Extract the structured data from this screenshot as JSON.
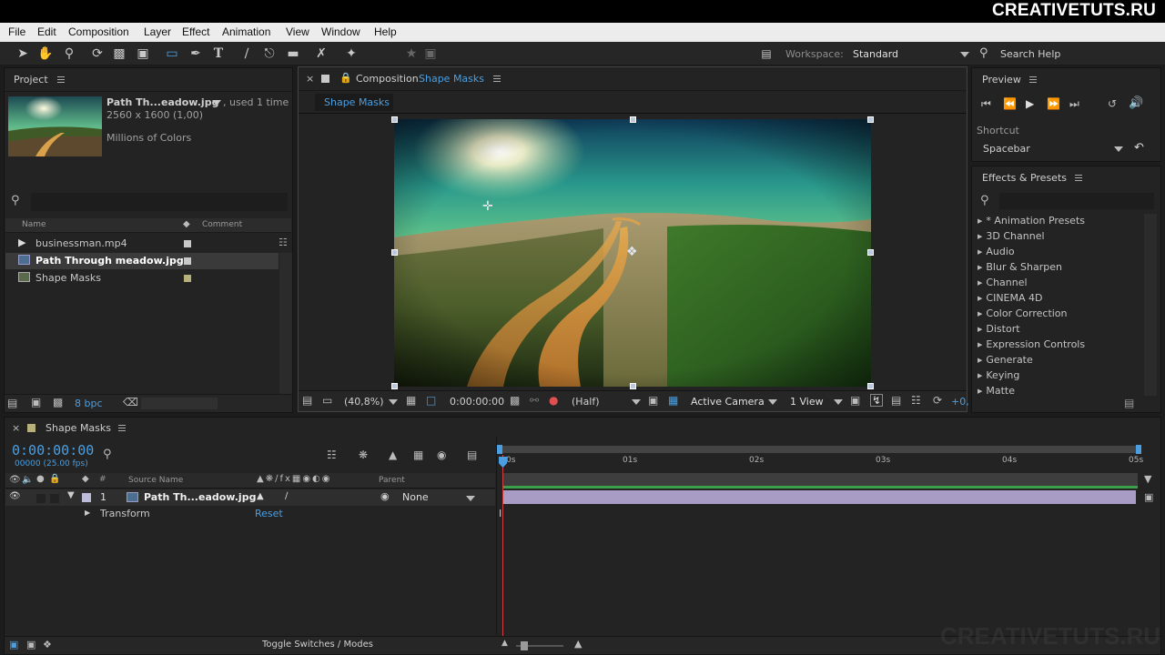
{
  "watermark": "CREATIVETUTS.RU",
  "menu": [
    "File",
    "Edit",
    "Composition",
    "Layer",
    "Effect",
    "Animation",
    "View",
    "Window",
    "Help"
  ],
  "toolbar": {
    "workspace_label": "Workspace:",
    "workspace_value": "Standard",
    "search_help_label": "Search Help"
  },
  "project": {
    "title": "Project",
    "preview_name": "Path Th...eadow.jpg",
    "preview_used": ", used 1 time",
    "preview_dims": "2560 x 1600 (1,00)",
    "preview_colors": "Millions of Colors",
    "columns": {
      "name": "Name",
      "comment": "Comment"
    },
    "items": [
      {
        "name": "businessman.mp4",
        "color": "#c9c9c9"
      },
      {
        "name": "Path Through meadow.jpg",
        "color": "#c9c9c9"
      },
      {
        "name": "Shape Masks",
        "color": "#b8b07a"
      }
    ],
    "bpc": "8 bpc"
  },
  "composition": {
    "panel_prefix": "Composition",
    "panel_name": "Shape Masks",
    "tab_label": "Shape Masks",
    "zoom": "(40,8%)",
    "timecode": "0:00:00:00",
    "resolution": "(Half)",
    "camera": "Active Camera",
    "views": "1 View",
    "exposure": "+0,"
  },
  "preview": {
    "title": "Preview",
    "shortcut_label": "Shortcut",
    "shortcut_value": "Spacebar"
  },
  "effects": {
    "title": "Effects & Presets",
    "items": [
      "* Animation Presets",
      "3D Channel",
      "Audio",
      "Blur & Sharpen",
      "Channel",
      "CINEMA 4D",
      "Color Correction",
      "Distort",
      "Expression Controls",
      "Generate",
      "Keying",
      "Matte"
    ]
  },
  "timeline": {
    "title": "Shape Masks",
    "timecode": "0:00:00:00",
    "frames": "00000 (25.00 fps)",
    "col_source": "Source Name",
    "col_parent": "Parent",
    "layer_num": "1",
    "layer_name": "Path Th...eadow.jpg",
    "layer_parent": "None",
    "transform_label": "Transform",
    "transform_reset": "Reset",
    "ticks": [
      "0s",
      "01s",
      "02s",
      "03s",
      "04s",
      "05s"
    ],
    "toggle_label": "Toggle Switches / Modes"
  }
}
